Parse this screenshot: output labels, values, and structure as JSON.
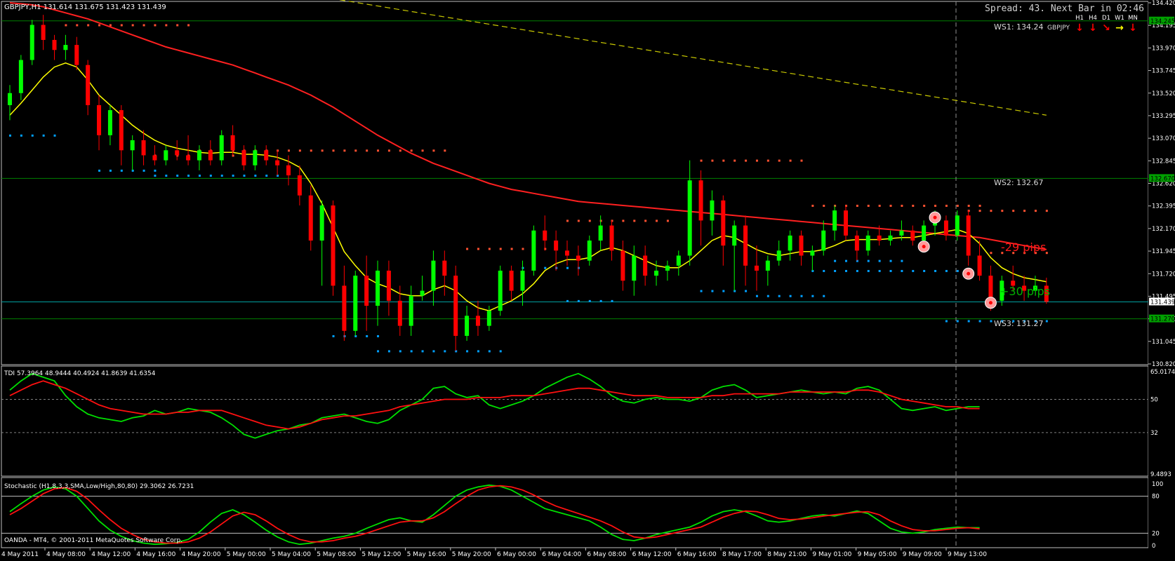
{
  "header": {
    "symbol_line": "GBPJPY,H1  131.614 131.675 131.423 131.439",
    "spread_text": "Spread: 43. Next Bar in 02:46",
    "tf_labels": [
      "H1",
      "H4",
      "D1",
      "W1",
      "MN"
    ],
    "tf_arrows": [
      {
        "glyph": "↓",
        "color": "#ff0000"
      },
      {
        "glyph": "↓",
        "color": "#ff0000"
      },
      {
        "glyph": "↘",
        "color": "#ff0000"
      },
      {
        "glyph": "→",
        "color": "#ffff00"
      },
      {
        "glyph": "↓",
        "color": "#ff0000"
      }
    ],
    "ws1_label": "WS1:  134.24",
    "ws1_symbol": "GBPJPY",
    "ws2_label": "WS2:  132.67",
    "ws3_label": "WS3:  131.27",
    "pips_red": "-29 pips",
    "pips_green": "+30 pips",
    "price_axis": [
      "134.420",
      "134.195",
      "133.970",
      "133.745",
      "133.520",
      "133.295",
      "133.070",
      "132.845",
      "132.620",
      "132.395",
      "132.170",
      "131.945",
      "131.720",
      "131.495",
      "131.270",
      "131.045",
      "130.820"
    ],
    "price_tags": [
      {
        "label": "134.245",
        "price": 134.24,
        "bg": "#00a000",
        "fg": "#000000"
      },
      {
        "label": "132.670",
        "price": 132.67,
        "bg": "#00a000",
        "fg": "#000000"
      },
      {
        "label": "131.439",
        "price": 131.439,
        "bg": "#ffffff",
        "fg": "#000000"
      },
      {
        "label": "131.270",
        "price": 131.27,
        "bg": "#00a000",
        "fg": "#000000"
      }
    ]
  },
  "tdi": {
    "label": "TDI 57.3964 48.9444 40.4924 41.8639 41.6354",
    "axis": [
      "65.0174",
      "50",
      "32",
      "9.4893"
    ],
    "green_line": [
      55,
      60,
      64,
      62,
      60,
      52,
      46,
      42,
      40,
      39,
      38,
      40,
      41,
      44,
      42,
      43,
      45,
      44,
      43,
      40,
      36,
      31,
      29,
      31,
      33,
      34,
      36,
      37,
      40,
      41,
      42,
      40,
      38,
      37,
      39,
      44,
      47,
      50,
      56,
      57,
      53,
      51,
      52,
      47,
      45,
      47,
      49,
      52,
      56,
      59,
      62,
      64,
      61,
      57,
      52,
      49,
      48,
      50,
      51,
      50,
      50,
      49,
      51,
      55,
      57,
      58,
      55,
      51,
      52,
      53,
      54,
      55,
      54,
      53,
      54,
      53,
      56,
      57,
      55,
      50,
      45,
      44,
      45,
      46,
      44,
      45,
      46,
      46
    ],
    "red_line": [
      52,
      55,
      58,
      60,
      58,
      56,
      53,
      50,
      47,
      45,
      44,
      43,
      42,
      42,
      42,
      43,
      43,
      44,
      44,
      44,
      42,
      40,
      38,
      36,
      35,
      34,
      35,
      37,
      39,
      40,
      41,
      41,
      42,
      43,
      44,
      46,
      47,
      48,
      49,
      50,
      50,
      50,
      51,
      51,
      51,
      52,
      52,
      52,
      53,
      54,
      55,
      56,
      56,
      55,
      54,
      53,
      52,
      52,
      52,
      51,
      51,
      51,
      51,
      52,
      52,
      53,
      53,
      53,
      53,
      53,
      54,
      54,
      54,
      54,
      54,
      54,
      55,
      55,
      54,
      52,
      50,
      49,
      48,
      47,
      46,
      46,
      45,
      45
    ],
    "levels": [
      50,
      32
    ]
  },
  "stoch": {
    "label": "Stochastic (H1,8,3,3,SMA,Low/High,80,80) 29.3062 26.7231",
    "axis": [
      "100",
      "80",
      "20",
      "0"
    ],
    "main_line": [
      55,
      68,
      80,
      90,
      95,
      92,
      80,
      60,
      40,
      25,
      15,
      8,
      4,
      2,
      3,
      5,
      10,
      22,
      38,
      52,
      58,
      50,
      38,
      25,
      14,
      6,
      2,
      4,
      8,
      12,
      15,
      20,
      28,
      35,
      42,
      45,
      40,
      38,
      50,
      65,
      80,
      90,
      95,
      98,
      96,
      90,
      80,
      70,
      60,
      55,
      50,
      45,
      40,
      30,
      18,
      10,
      8,
      12,
      18,
      22,
      26,
      30,
      38,
      48,
      55,
      58,
      55,
      48,
      40,
      38,
      40,
      44,
      48,
      50,
      48,
      52,
      56,
      52,
      40,
      28,
      22,
      20,
      22,
      26,
      28,
      30,
      29,
      29
    ],
    "signal_line": [
      50,
      60,
      72,
      84,
      92,
      94,
      88,
      75,
      58,
      42,
      28,
      18,
      10,
      6,
      4,
      4,
      6,
      12,
      22,
      35,
      48,
      54,
      50,
      40,
      28,
      18,
      10,
      6,
      6,
      8,
      12,
      15,
      20,
      26,
      32,
      38,
      40,
      40,
      45,
      55,
      68,
      80,
      90,
      95,
      97,
      95,
      90,
      82,
      72,
      64,
      58,
      52,
      46,
      40,
      32,
      22,
      14,
      12,
      14,
      18,
      22,
      26,
      30,
      38,
      46,
      52,
      56,
      55,
      50,
      44,
      42,
      43,
      45,
      48,
      50,
      52,
      54,
      55,
      50,
      40,
      32,
      26,
      24,
      24,
      26,
      28,
      29,
      27
    ],
    "levels": [
      80,
      20
    ]
  },
  "footer": {
    "copyright": "OANDA - MT4, © 2001-2011 MetaQuotes Software Corp.",
    "first_date": "4 May 2011",
    "time_labels": [
      "4 May 08:00",
      "4 May 12:00",
      "4 May 16:00",
      "4 May 20:00",
      "5 May 00:00",
      "5 May 04:00",
      "5 May 08:00",
      "5 May 12:00",
      "5 May 16:00",
      "5 May 20:00",
      "6 May 00:00",
      "6 May 04:00",
      "6 May 08:00",
      "6 May 12:00",
      "6 May 16:00",
      "8 May 17:00",
      "8 May 21:00",
      "9 May 01:00",
      "9 May 05:00",
      "9 May 09:00",
      "9 May 13:00"
    ]
  },
  "chart_data": {
    "type": "candlestick",
    "symbol": "GBPJPY",
    "timeframe": "H1",
    "ylim": [
      130.82,
      134.42
    ],
    "colors": {
      "bull": "#00ff00",
      "bear": "#ff0000",
      "fast_ma": "#ffff00",
      "slow_ma": "#ff2020",
      "trend": "#c8c800",
      "res_dots": "#ff5030",
      "sup_dots": "#00a0ff",
      "level_line": "#008000"
    },
    "ohlc": [
      [
        133.4,
        133.6,
        133.25,
        133.52
      ],
      [
        133.52,
        133.9,
        133.45,
        133.85
      ],
      [
        133.85,
        134.25,
        133.8,
        134.2
      ],
      [
        134.2,
        134.3,
        133.95,
        134.05
      ],
      [
        134.05,
        134.1,
        133.85,
        133.95
      ],
      [
        133.95,
        134.1,
        133.85,
        134.0
      ],
      [
        134.0,
        134.08,
        133.75,
        133.8
      ],
      [
        133.8,
        133.85,
        133.3,
        133.4
      ],
      [
        133.4,
        133.5,
        132.95,
        133.1
      ],
      [
        133.1,
        133.4,
        133.0,
        133.35
      ],
      [
        133.35,
        133.4,
        132.8,
        132.95
      ],
      [
        132.95,
        133.1,
        132.75,
        133.05
      ],
      [
        133.05,
        133.15,
        132.8,
        132.9
      ],
      [
        132.9,
        133.0,
        132.8,
        132.85
      ],
      [
        132.85,
        133.0,
        132.8,
        132.95
      ],
      [
        132.95,
        133.05,
        132.85,
        132.9
      ],
      [
        132.9,
        133.1,
        132.8,
        132.85
      ],
      [
        132.85,
        133.0,
        132.75,
        132.95
      ],
      [
        132.95,
        133.05,
        132.8,
        132.85
      ],
      [
        132.85,
        133.15,
        132.8,
        133.1
      ],
      [
        133.1,
        133.2,
        132.9,
        132.95
      ],
      [
        132.95,
        133.0,
        132.75,
        132.8
      ],
      [
        132.8,
        133.0,
        132.75,
        132.95
      ],
      [
        132.95,
        133.0,
        132.8,
        132.85
      ],
      [
        132.85,
        132.95,
        132.7,
        132.8
      ],
      [
        132.8,
        132.9,
        132.6,
        132.7
      ],
      [
        132.7,
        132.8,
        132.4,
        132.5
      ],
      [
        132.5,
        132.6,
        131.95,
        132.05
      ],
      [
        132.05,
        132.45,
        131.6,
        132.4
      ],
      [
        132.4,
        132.45,
        131.5,
        131.6
      ],
      [
        131.6,
        131.8,
        131.05,
        131.15
      ],
      [
        131.15,
        131.75,
        131.1,
        131.7
      ],
      [
        131.7,
        131.9,
        131.15,
        131.4
      ],
      [
        131.4,
        131.85,
        131.2,
        131.75
      ],
      [
        131.75,
        131.85,
        131.3,
        131.45
      ],
      [
        131.45,
        131.6,
        131.1,
        131.2
      ],
      [
        131.2,
        131.6,
        131.1,
        131.5
      ],
      [
        131.5,
        131.7,
        131.45,
        131.55
      ],
      [
        131.55,
        131.95,
        131.4,
        131.85
      ],
      [
        131.85,
        131.95,
        131.5,
        131.7
      ],
      [
        131.7,
        131.8,
        130.95,
        131.1
      ],
      [
        131.1,
        131.4,
        131.05,
        131.3
      ],
      [
        131.3,
        131.45,
        131.1,
        131.2
      ],
      [
        131.2,
        131.4,
        131.15,
        131.35
      ],
      [
        131.35,
        131.8,
        131.3,
        131.75
      ],
      [
        131.75,
        131.8,
        131.45,
        131.55
      ],
      [
        131.55,
        131.85,
        131.4,
        131.75
      ],
      [
        131.75,
        132.2,
        131.7,
        132.15
      ],
      [
        132.15,
        132.3,
        131.95,
        132.05
      ],
      [
        132.05,
        132.15,
        131.75,
        131.95
      ],
      [
        131.95,
        132.05,
        131.8,
        131.9
      ],
      [
        131.9,
        132.0,
        131.7,
        131.85
      ],
      [
        131.85,
        132.1,
        131.8,
        132.05
      ],
      [
        132.05,
        132.3,
        131.95,
        132.2
      ],
      [
        132.2,
        132.25,
        131.85,
        131.95
      ],
      [
        131.95,
        132.05,
        131.55,
        131.65
      ],
      [
        131.65,
        132.0,
        131.5,
        131.9
      ],
      [
        131.9,
        132.0,
        131.6,
        131.7
      ],
      [
        131.7,
        131.85,
        131.6,
        131.75
      ],
      [
        131.75,
        131.85,
        131.65,
        131.8
      ],
      [
        131.8,
        131.95,
        131.7,
        131.9
      ],
      [
        131.9,
        132.85,
        131.8,
        132.65
      ],
      [
        132.65,
        132.75,
        132.0,
        132.25
      ],
      [
        132.25,
        132.55,
        132.1,
        132.45
      ],
      [
        132.45,
        132.5,
        131.8,
        132.0
      ],
      [
        132.0,
        132.25,
        131.55,
        132.2
      ],
      [
        132.2,
        132.3,
        131.6,
        131.8
      ],
      [
        131.8,
        132.0,
        131.55,
        131.75
      ],
      [
        131.75,
        131.9,
        131.6,
        131.85
      ],
      [
        131.85,
        132.05,
        131.8,
        131.95
      ],
      [
        131.95,
        132.15,
        131.85,
        132.1
      ],
      [
        132.1,
        132.15,
        131.8,
        131.9
      ],
      [
        131.9,
        132.0,
        131.75,
        131.95
      ],
      [
        131.95,
        132.25,
        131.9,
        132.15
      ],
      [
        132.15,
        132.4,
        132.05,
        132.35
      ],
      [
        132.35,
        132.4,
        132.05,
        132.1
      ],
      [
        132.1,
        132.15,
        131.85,
        131.95
      ],
      [
        131.95,
        132.15,
        131.9,
        132.1
      ],
      [
        132.1,
        132.2,
        132.0,
        132.05
      ],
      [
        132.05,
        132.15,
        132.0,
        132.1
      ],
      [
        132.1,
        132.25,
        132.05,
        132.15
      ],
      [
        132.15,
        132.2,
        132.0,
        132.05
      ],
      [
        132.05,
        132.25,
        131.95,
        132.2
      ],
      [
        132.2,
        132.35,
        132.1,
        132.25
      ],
      [
        132.25,
        132.3,
        132.05,
        132.1
      ],
      [
        132.1,
        132.35,
        132.05,
        132.3
      ],
      [
        132.3,
        132.35,
        131.8,
        131.9
      ],
      [
        131.9,
        132.05,
        131.65,
        131.7
      ],
      [
        131.7,
        131.8,
        131.35,
        131.45
      ],
      [
        131.45,
        131.7,
        131.4,
        131.65
      ],
      [
        131.65,
        131.8,
        131.55,
        131.6
      ],
      [
        131.6,
        131.7,
        131.45,
        131.55
      ],
      [
        131.55,
        131.7,
        131.5,
        131.6
      ],
      [
        131.6,
        131.68,
        131.42,
        131.44
      ]
    ],
    "fast_ma": [
      133.3,
      133.42,
      133.55,
      133.68,
      133.78,
      133.82,
      133.78,
      133.65,
      133.5,
      133.4,
      133.3,
      133.2,
      133.12,
      133.05,
      133.0,
      132.97,
      132.95,
      132.93,
      132.92,
      132.93,
      132.93,
      132.91,
      132.91,
      132.9,
      132.88,
      132.84,
      132.78,
      132.62,
      132.42,
      132.18,
      131.94,
      131.8,
      131.68,
      131.62,
      131.58,
      131.52,
      131.5,
      131.5,
      131.56,
      131.6,
      131.55,
      131.45,
      131.38,
      131.35,
      131.4,
      131.45,
      131.52,
      131.62,
      131.75,
      131.82,
      131.86,
      131.86,
      131.88,
      131.95,
      131.98,
      131.95,
      131.9,
      131.85,
      131.8,
      131.78,
      131.78,
      131.85,
      131.95,
      132.05,
      132.1,
      132.08,
      132.02,
      131.96,
      131.92,
      131.9,
      131.92,
      131.94,
      131.94,
      131.96,
      132.0,
      132.05,
      132.06,
      132.06,
      132.06,
      132.07,
      132.08,
      132.08,
      132.1,
      132.12,
      132.14,
      132.16,
      132.12,
      132.02,
      131.88,
      131.78,
      131.72,
      131.68,
      131.66,
      131.64
    ],
    "slow_ma": [
      134.42,
      134.41,
      134.4,
      134.38,
      134.35,
      134.32,
      134.29,
      134.26,
      134.22,
      134.18,
      134.14,
      134.1,
      134.06,
      134.02,
      133.98,
      133.95,
      133.92,
      133.89,
      133.86,
      133.83,
      133.8,
      133.76,
      133.72,
      133.68,
      133.64,
      133.6,
      133.55,
      133.5,
      133.44,
      133.38,
      133.31,
      133.24,
      133.17,
      133.1,
      133.04,
      132.98,
      132.92,
      132.87,
      132.82,
      132.78,
      132.74,
      132.7,
      132.66,
      132.62,
      132.59,
      132.56,
      132.54,
      132.52,
      132.5,
      132.48,
      132.46,
      132.44,
      132.43,
      132.42,
      132.41,
      132.4,
      132.39,
      132.38,
      132.37,
      132.36,
      132.35,
      132.34,
      132.33,
      132.32,
      132.31,
      132.3,
      132.29,
      132.28,
      132.27,
      132.26,
      132.25,
      132.24,
      132.23,
      132.22,
      132.21,
      132.2,
      132.19,
      132.18,
      132.17,
      132.16,
      132.15,
      132.14,
      132.13,
      132.12,
      132.11,
      132.1,
      132.09,
      132.08,
      132.06,
      132.04,
      132.02,
      132.0,
      131.98,
      131.96
    ],
    "trend_line": {
      "from": [
        0,
        134.45
      ],
      "to": [
        93,
        133.3
      ]
    },
    "resistance_dots": [
      {
        "from": 5,
        "to": 16,
        "price": 134.2
      },
      {
        "from": 13,
        "to": 22,
        "price": 132.9
      },
      {
        "from": 17,
        "to": 39,
        "price": 132.95
      },
      {
        "from": 41,
        "to": 48,
        "price": 131.97
      },
      {
        "from": 50,
        "to": 59,
        "price": 132.25
      },
      {
        "from": 62,
        "to": 71,
        "price": 132.85
      },
      {
        "from": 72,
        "to": 87,
        "price": 132.4
      },
      {
        "from": 86,
        "to": 93,
        "price": 132.35
      },
      {
        "from": 88,
        "to": 93,
        "price": 131.93
      }
    ],
    "support_dots": [
      {
        "from": 0,
        "to": 4,
        "price": 133.1
      },
      {
        "from": 8,
        "to": 13,
        "price": 132.75
      },
      {
        "from": 13,
        "to": 24,
        "price": 132.7
      },
      {
        "from": 29,
        "to": 33,
        "price": 131.1
      },
      {
        "from": 33,
        "to": 44,
        "price": 130.95
      },
      {
        "from": 46,
        "to": 51,
        "price": 131.78
      },
      {
        "from": 50,
        "to": 54,
        "price": 131.45
      },
      {
        "from": 62,
        "to": 66,
        "price": 131.55
      },
      {
        "from": 67,
        "to": 73,
        "price": 131.5
      },
      {
        "from": 72,
        "to": 85,
        "price": 131.75
      },
      {
        "from": 74,
        "to": 80,
        "price": 131.85
      },
      {
        "from": 84,
        "to": 93,
        "price": 131.25
      }
    ],
    "levels": [
      {
        "name": "WS1",
        "price": 134.24
      },
      {
        "name": "WS2",
        "price": 132.67
      },
      {
        "name": "WS3",
        "price": 131.27
      },
      {
        "name": "current",
        "price": 131.439
      }
    ],
    "signals": [
      {
        "bar": 83,
        "price": 132.28
      },
      {
        "bar": 82,
        "price": 131.99
      },
      {
        "bar": 86,
        "price": 131.72
      },
      {
        "bar": 88,
        "price": 131.43
      }
    ],
    "tdi_levels": [
      50,
      32
    ],
    "stoch_levels": [
      80,
      20
    ]
  }
}
